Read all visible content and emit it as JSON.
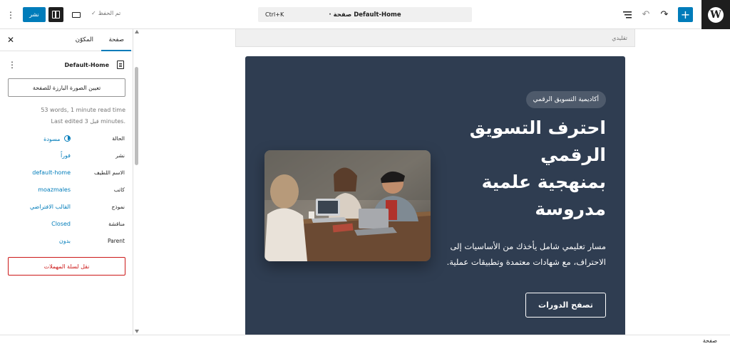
{
  "topbar": {
    "document_title": "Default-Home",
    "document_type": "· صفحة",
    "shortcut": "Ctrl+K",
    "saved_label": "تم الحفظ",
    "publish_label": "نشر"
  },
  "sidebar": {
    "tabs": {
      "page": "صفحة",
      "block": "المكوّن"
    },
    "doc_name": "Default-Home",
    "featured_image_label": "تعيين الصورة البارزة للصفحة",
    "meta_line1": "53 words, 1 minute read time",
    "meta_line2": "Last edited قبل 3 minutes.",
    "properties": [
      {
        "label": "الحالة",
        "value": "مسودة"
      },
      {
        "label": "نشر",
        "value": "فوراً"
      },
      {
        "label": "الاسم اللطيف",
        "value": "default-home"
      },
      {
        "label": "كاتب",
        "value": "moazmales"
      },
      {
        "label": "نموذج",
        "value": "القالب الافتراضي"
      },
      {
        "label": "مناقشة",
        "value": "Closed"
      },
      {
        "label": "Parent",
        "value": "بدون"
      }
    ],
    "trash_label": "نقل لسلة المهملات"
  },
  "canvas": {
    "template_label": "تقليدي",
    "badge": "أكاديمية التسويق الرقمي",
    "title_line1": "احترف التسويق",
    "title_line2": "الرقمي",
    "title_line3": "بمنهجية علمية",
    "title_line4": "مدروسة",
    "description": "مسار تعليمي شامل يأخذك من الأساسيات إلى الاحتراف، مع شهادات معتمدة وتطبيقات عملية.",
    "cta_label": "تصفح الدورات"
  },
  "footer": {
    "breadcrumb": "صفحة"
  },
  "colors": {
    "accent": "#007cba",
    "hero_bg": "#2f3d51",
    "danger": "#cc1818"
  },
  "icons": [
    "wordpress-logo-icon",
    "plus-icon",
    "redo-icon",
    "undo-icon",
    "document-overview-icon",
    "more-vertical-icon",
    "sidebar-toggle-icon",
    "desktop-preview-icon",
    "check-icon",
    "close-icon",
    "page-icon",
    "post-status-icon"
  ]
}
